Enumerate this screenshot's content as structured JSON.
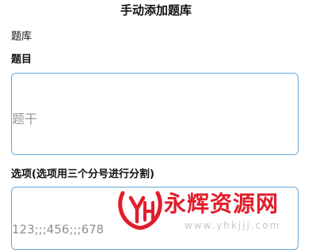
{
  "header": {
    "title": "手动添加题库"
  },
  "form": {
    "bank_label": "题库",
    "question_label": "题目",
    "question_placeholder": "题干",
    "options_label": "选项(选项用三个分号进行分割)",
    "options_placeholder": "123;;;456;;;678"
  },
  "watermark": {
    "logo_text": "YH",
    "brand_text": "永辉资源网",
    "url": "www.yhkjjj.com",
    "color": "#e11d2b"
  },
  "colors": {
    "field_border": "#6aa8d6",
    "placeholder": "#9a9a9a"
  }
}
